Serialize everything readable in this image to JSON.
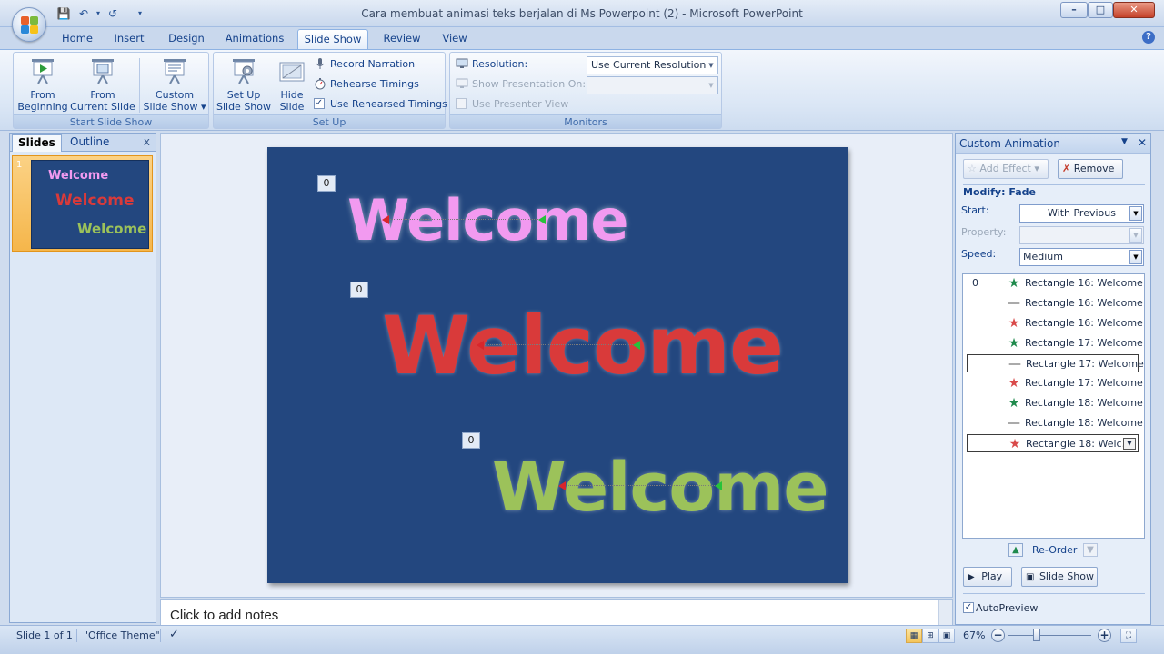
{
  "window": {
    "title": "Cara membuat animasi teks berjalan di Ms Powerpoint (2) - Microsoft PowerPoint",
    "minimize": "–",
    "maximize": "□",
    "close": "✕"
  },
  "ribbon_tabs": [
    "Home",
    "Insert",
    "Design",
    "Animations",
    "Slide Show",
    "Review",
    "View"
  ],
  "active_tab": "Slide Show",
  "ribbon": {
    "start_group": {
      "label": "Start Slide Show",
      "from_beginning": [
        "From",
        "Beginning"
      ],
      "from_current": [
        "From",
        "Current Slide"
      ],
      "custom": [
        "Custom",
        "Slide Show ▾"
      ]
    },
    "setup_group": {
      "label": "Set Up",
      "setup_show": [
        "Set Up",
        "Slide Show"
      ],
      "hide_slide": [
        "Hide",
        "Slide"
      ],
      "record_narration": "Record Narration",
      "rehearse_timings": "Rehearse Timings",
      "use_rehearsed": "Use Rehearsed Timings",
      "use_rehearsed_checked": true
    },
    "monitors_group": {
      "label": "Monitors",
      "resolution_label": "Resolution:",
      "resolution_value": "Use Current Resolution",
      "show_on_label": "Show Presentation On:",
      "show_on_value": "",
      "presenter_view": "Use Presenter View",
      "presenter_view_checked": false
    }
  },
  "left_panel": {
    "tabs": [
      "Slides",
      "Outline"
    ],
    "active_tab": "Slides",
    "close": "x",
    "slide_number": "1",
    "thumbnail_texts": [
      "Welcome",
      "Welcome",
      "Welcome"
    ]
  },
  "slide": {
    "texts": [
      {
        "text": "Welcome",
        "color": "#f29af0"
      },
      {
        "text": "Welcome",
        "color": "#d93a3a"
      },
      {
        "text": "Welcome",
        "color": "#9cc25a"
      }
    ],
    "tags": [
      "0",
      "0",
      "0"
    ]
  },
  "notes": {
    "placeholder": "Click to add notes"
  },
  "anim_pane": {
    "title": "Custom Animation",
    "add_effect": "Add Effect ▾",
    "remove": "Remove",
    "modify": "Modify: Fade",
    "start_label": "Start:",
    "start_value": "With Previous",
    "property_label": "Property:",
    "property_value": "",
    "speed_label": "Speed:",
    "speed_value": "Medium",
    "items": [
      {
        "num": "0",
        "icon": "star-green",
        "label": "Rectangle 16: Welcome",
        "selected": false
      },
      {
        "num": "",
        "icon": "path-line",
        "label": "Rectangle 16: Welcome",
        "selected": false
      },
      {
        "num": "",
        "icon": "star-red",
        "label": "Rectangle 16: Welcome",
        "selected": false
      },
      {
        "num": "",
        "icon": "star-green",
        "label": "Rectangle 17: Welcome",
        "selected": false
      },
      {
        "num": "",
        "icon": "path-line",
        "label": "Rectangle 17: Welcome",
        "selected": true
      },
      {
        "num": "",
        "icon": "star-red",
        "label": "Rectangle 17: Welcome",
        "selected": false
      },
      {
        "num": "",
        "icon": "star-green",
        "label": "Rectangle 18: Welcome",
        "selected": false
      },
      {
        "num": "",
        "icon": "path-line",
        "label": "Rectangle 18: Welcome",
        "selected": false
      },
      {
        "num": "",
        "icon": "star-red",
        "label": "Rectangle 18: Welc…",
        "selected": true
      }
    ],
    "reorder": "Re-Order",
    "play": "Play",
    "slide_show": "Slide Show",
    "autopreview": "AutoPreview",
    "autopreview_checked": true
  },
  "status": {
    "slide_info": "Slide 1 of 1",
    "theme": "\"Office Theme\"",
    "zoom": "67%",
    "zoom_fraction": 0.35
  },
  "colors": {
    "slide_bg": "#23477f",
    "ribbon_text": "#15428b",
    "green_star": "#1f8a4c",
    "red_star": "#d94a4a"
  }
}
